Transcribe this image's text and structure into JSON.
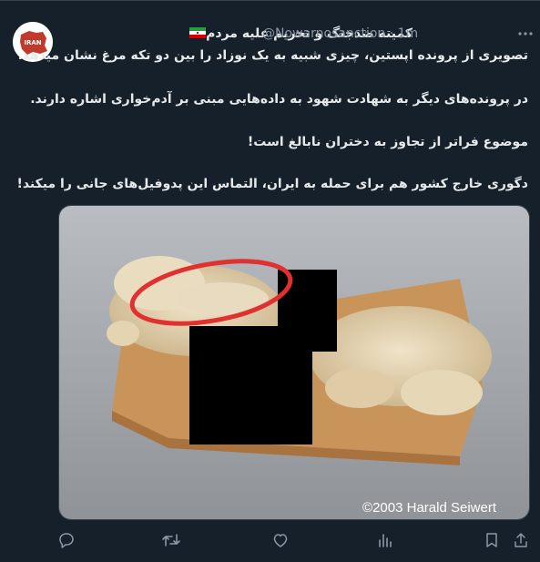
{
  "tweet": {
    "display_name": "کمیته ضدجنگ و تحریم علیه مردم",
    "handle_time": "@Nowarnosanction · 1m",
    "more_icon": "more-horizontal-icon",
    "avatar_icon": "iran-map-avatar",
    "avatar_text": "IRAN",
    "flag_icon": "iran-flag-icon",
    "lines": [
      "تصویری از پرونده اپستین، چیزی شبیه به یک نوزاد را بین دو تکه مرغ نشان میدهد.",
      "در پرونده‌های دیگر به شهادت شهود به داده‌هایی مبنی بر آدم‌خواری اشاره دارند.",
      "موضوع فراتر از تجاوز به دختران نابالغ است!",
      "دگوری خارج کشور هم برای حمله به ایران، التماس این پدوفیل‌های جانی را میکند!"
    ]
  },
  "media": {
    "watermark": "©2003 Harald Seiwert",
    "description_icon": "photo-raw-chicken-redacted"
  },
  "actions": [
    "reply-icon",
    "retweet-icon",
    "like-icon",
    "views-icon",
    "bookmark-icon",
    "share-icon"
  ],
  "colors": {
    "background": "#15202b",
    "text": "#e7e9ea",
    "secondary": "#8b98a5",
    "annotation_red": "#e03030"
  }
}
